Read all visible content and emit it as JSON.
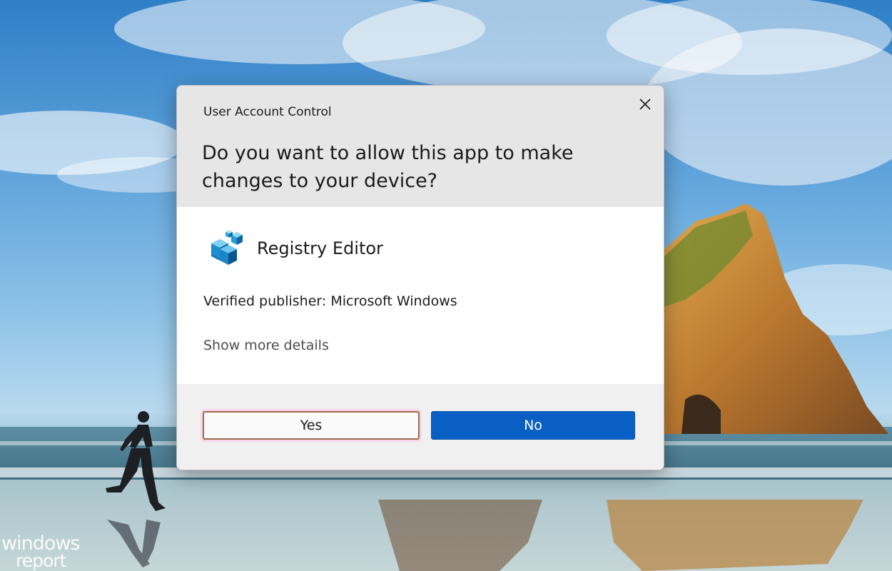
{
  "watermark": {
    "line1": "windows",
    "line2": "report"
  },
  "dialog": {
    "title": "User Account Control",
    "question": "Do you want to allow this app to make changes to your device?",
    "close_icon": "close-icon",
    "app": {
      "icon": "registry-editor-icon",
      "name": "Registry Editor"
    },
    "publisher": "Verified publisher: Microsoft Windows",
    "details_link": "Show more details",
    "buttons": {
      "yes": "Yes",
      "no": "No"
    }
  },
  "colors": {
    "header_bg": "#e6e6e6",
    "footer_bg": "#f0f0f0",
    "primary_button": "#0a5fc4",
    "focus_border": "#9a6a4a"
  }
}
